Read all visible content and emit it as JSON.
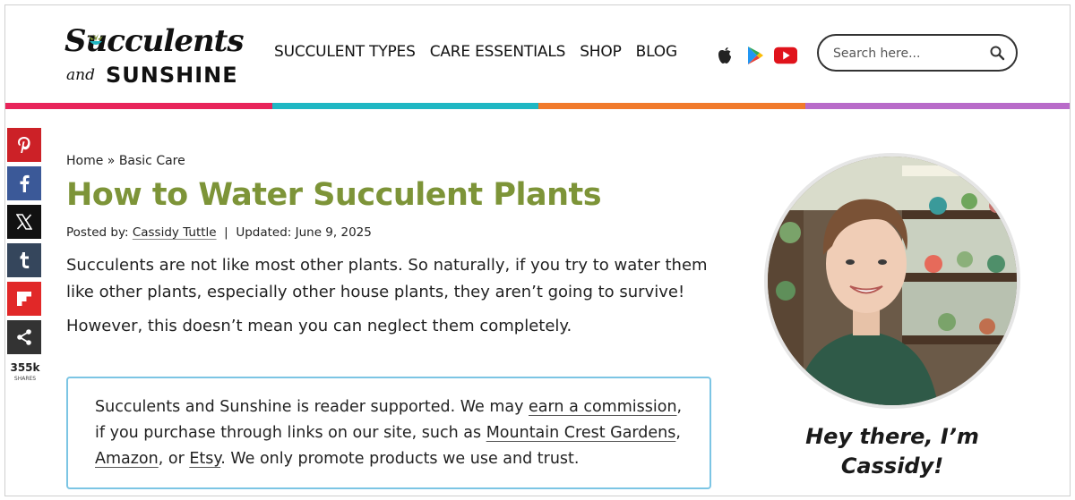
{
  "header": {
    "logo_top": "Succulents",
    "logo_and": "and",
    "logo_bottom": "SUNSHINE",
    "nav": [
      "SUCCULENT TYPES",
      "CARE ESSENTIALS",
      "SHOP",
      "BLOG"
    ],
    "app_icons": [
      "apple-icon",
      "google-play-icon",
      "youtube-icon"
    ],
    "search_placeholder": "Search here..."
  },
  "stripe_colors": [
    "#e8245a",
    "#1fb7c3",
    "#f17a2b",
    "#b86bc9"
  ],
  "share": {
    "buttons": [
      {
        "icon": "pinterest-icon",
        "color": "#cc2127"
      },
      {
        "icon": "facebook-icon",
        "color": "#3b5998"
      },
      {
        "icon": "x-icon",
        "color": "#111111"
      },
      {
        "icon": "tumblr-icon",
        "color": "#35465c"
      },
      {
        "icon": "flipboard-icon",
        "color": "#e12828"
      },
      {
        "icon": "share-icon",
        "color": "#333333"
      }
    ],
    "count": "355k",
    "count_label": "SHARES"
  },
  "article": {
    "breadcrumb_home": "Home",
    "breadcrumb_sep": " » ",
    "breadcrumb_section": "Basic Care",
    "title": "How to Water Succulent Plants",
    "posted_by_label": "Posted by: ",
    "author": "Cassidy Tuttle",
    "meta_sep": "  |  ",
    "updated": "Updated: June 9, 2025",
    "p1": "Succulents are not like most other plants. So naturally, if you try to water them like other plants, especially other house plants, they aren’t going to survive!",
    "p2": "However, this doesn’t mean you can neglect them completely."
  },
  "notice": {
    "t1": "Succulents and Sunshine is reader supported. We may ",
    "link1": "earn a commission",
    "t2": ", if you purchase through links on our site, such as ",
    "link2": "Mountain Crest Gardens",
    "t3": ", ",
    "link3": "Amazon",
    "t4": ", or ",
    "link4": "Etsy",
    "t5": ". We only promote products we use and trust."
  },
  "sidebar": {
    "greeting": "Hey there, I’m Cassidy!"
  }
}
